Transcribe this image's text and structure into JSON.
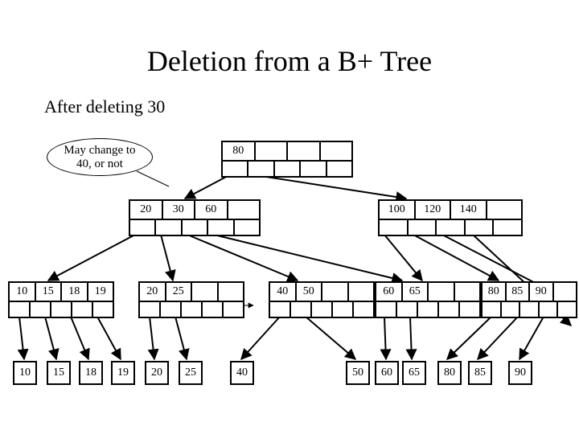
{
  "title": "Deletion from a B+ Tree",
  "subtitle": "After deleting 30",
  "callout": {
    "line1": "May change to",
    "line2": "40, or not"
  },
  "root": {
    "keys": [
      "80",
      "",
      "",
      ""
    ]
  },
  "lvl1": {
    "left": {
      "keys": [
        "20",
        "30",
        "60",
        ""
      ]
    },
    "right": {
      "keys": [
        "100",
        "120",
        "140",
        ""
      ]
    }
  },
  "lvl2": {
    "n0": {
      "keys": [
        "10",
        "15",
        "18",
        "19"
      ]
    },
    "n1": {
      "keys": [
        "20",
        "25",
        "",
        ""
      ]
    },
    "n2": {
      "keys": [
        "40",
        "50",
        "",
        ""
      ]
    },
    "n3": {
      "keys": [
        "60",
        "65",
        "",
        ""
      ]
    },
    "n4": {
      "keys": [
        "80",
        "85",
        "90",
        ""
      ]
    }
  },
  "leaves": [
    "10",
    "15",
    "18",
    "19",
    "20",
    "25",
    "40",
    "50",
    "60",
    "65",
    "80",
    "85",
    "90"
  ]
}
